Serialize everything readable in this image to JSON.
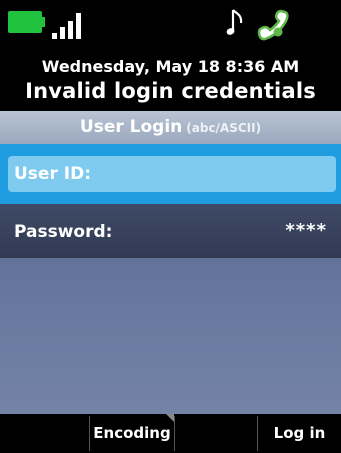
{
  "status_bar": {
    "battery_icon": "battery-icon",
    "battery_color": "#21c23d",
    "signal_icon": "signal-strength-icon",
    "music_icon": "music-note-icon",
    "handset_icon": "handset-icon",
    "handset_color": "#5fb84a"
  },
  "header": {
    "date_time": "Wednesday, May 18 8:36 AM",
    "message": "Invalid login credentials"
  },
  "form": {
    "title": "User Login",
    "subtitle": "(abc/ASCII)",
    "user_id_label": "User ID:",
    "password_label": "Password:",
    "password_value": "****",
    "highlight_color": "#1f9be0"
  },
  "softkeys": {
    "key1": "",
    "key2": "Encoding",
    "key3": "",
    "key4": "Log in"
  }
}
